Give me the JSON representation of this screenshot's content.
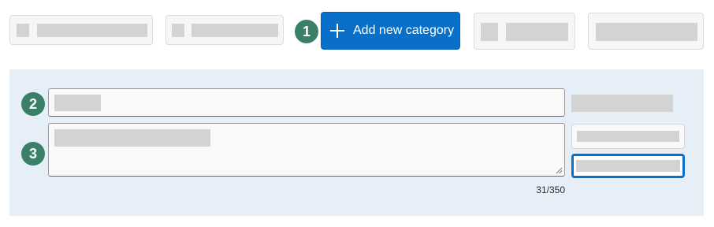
{
  "toolbar": {
    "add_category_label": "Add new category"
  },
  "steps": {
    "one": "1",
    "two": "2",
    "three": "3"
  },
  "description": {
    "char_count": "31/350"
  },
  "colors": {
    "primary": "#0870c9",
    "badge": "#3a7f67",
    "panel": "#e6eff7"
  }
}
